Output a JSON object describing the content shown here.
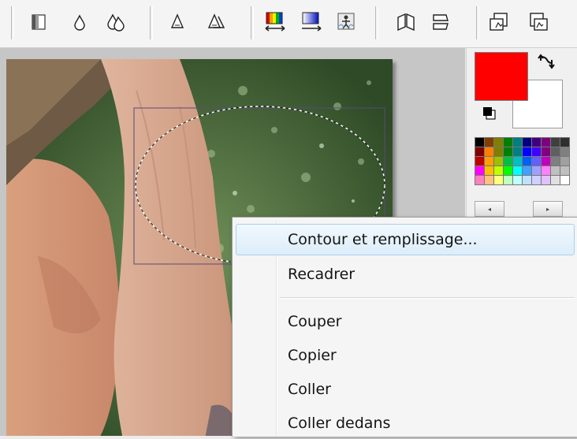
{
  "toolbar": {
    "icons": [
      "gradient-fill-icon",
      "drop-icon",
      "double-drop-icon",
      "sharpen-icon",
      "double-sharpen-icon",
      "color-gradient-arrow-icon",
      "blue-gradient-arrow-icon",
      "effect-figure-icon",
      "flip-horizontal-icon",
      "flip-vertical-icon",
      "rotate-left-icon",
      "rotate-right-icon"
    ]
  },
  "colors": {
    "foreground": "#ff0000",
    "background": "#ffffff",
    "palette": [
      "#000000",
      "#7f3f00",
      "#807f00",
      "#007f00",
      "#007f7f",
      "#00007f",
      "#3f007f",
      "#7f007f",
      "#3f3f3f",
      "#2f2f2f",
      "#7f0000",
      "#ff8000",
      "#7f7f00",
      "#008000",
      "#008080",
      "#0000ff",
      "#4000ff",
      "#800080",
      "#5f5f5f",
      "#808080",
      "#c00000",
      "#ff9f00",
      "#9fbf00",
      "#00bf40",
      "#00bfbf",
      "#0060ff",
      "#6060ff",
      "#bf00bf",
      "#7f7f7f",
      "#a0a0a0",
      "#ff00ff",
      "#ffbf00",
      "#bfff00",
      "#00ff00",
      "#00ffff",
      "#40a0ff",
      "#a0a0ff",
      "#ff80ff",
      "#c0c0c0",
      "#bfbfbf",
      "#ff80c0",
      "#ffc080",
      "#ffff80",
      "#c0ffc0",
      "#c0ffff",
      "#c0e0ff",
      "#d0d0ff",
      "#e0c0ff",
      "#e0e0e0",
      "#ffffff"
    ]
  },
  "palette_nav": {
    "prev_glyph": "◂",
    "next_glyph": "▸"
  },
  "context_menu": {
    "items": [
      {
        "label": "Contour et remplissage...",
        "highlighted": true
      },
      {
        "label": "Recadrer",
        "highlighted": false
      },
      {
        "label": "Couper",
        "highlighted": false
      },
      {
        "label": "Copier",
        "highlighted": false
      },
      {
        "label": "Coller",
        "highlighted": false
      },
      {
        "label": "Coller dedans",
        "highlighted": false
      }
    ]
  }
}
